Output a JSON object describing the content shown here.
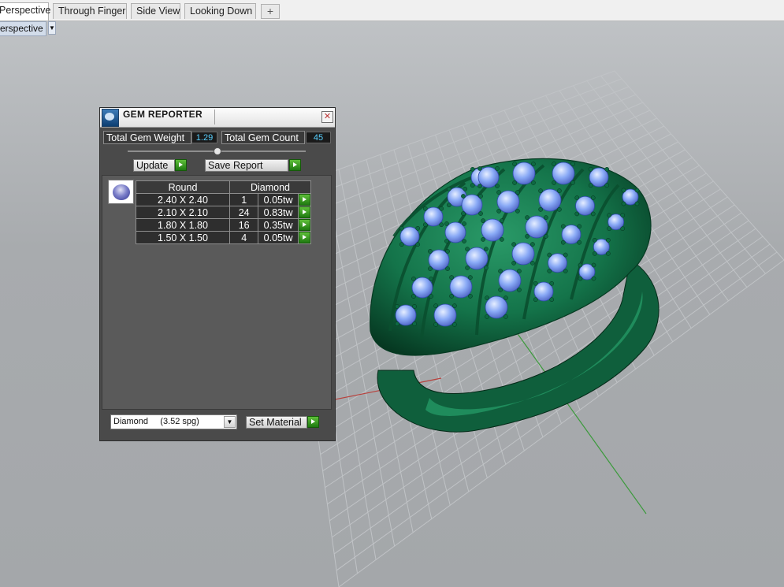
{
  "tabs": [
    {
      "label": "Perspective",
      "active": true
    },
    {
      "label": "Through Finger",
      "active": false
    },
    {
      "label": "Side View",
      "active": false
    },
    {
      "label": "Looking Down",
      "active": false
    }
  ],
  "add_tab_glyph": "+",
  "viewport": {
    "label": "erspective",
    "dropdown_glyph": "▼",
    "background_color": "#a9acaf",
    "grid_color": "#c3c6c9",
    "ring_color": "#1a7a50",
    "gem_color": "#8fb0ff"
  },
  "gem_reporter": {
    "title": "GEM REPORTER",
    "close_glyph": "✕",
    "total_weight_label": "Total Gem Weight",
    "total_weight_value": "1.29",
    "total_count_label": "Total Gem Count",
    "total_count_value": "45",
    "update_label": "Update",
    "save_report_label": "Save Report",
    "table": {
      "headers": [
        "Round",
        "Diamond"
      ],
      "rows": [
        {
          "size": "2.40 X 2.40",
          "count": "1",
          "weight": "0.05tw"
        },
        {
          "size": "2.10 X 2.10",
          "count": "24",
          "weight": "0.83tw"
        },
        {
          "size": "1.80 X 1.80",
          "count": "16",
          "weight": "0.35tw"
        },
        {
          "size": "1.50 X 1.50",
          "count": "4",
          "weight": "0.05tw"
        }
      ]
    },
    "material_select": "Diamond     (3.52 spg)",
    "set_material_label": "Set Material"
  }
}
